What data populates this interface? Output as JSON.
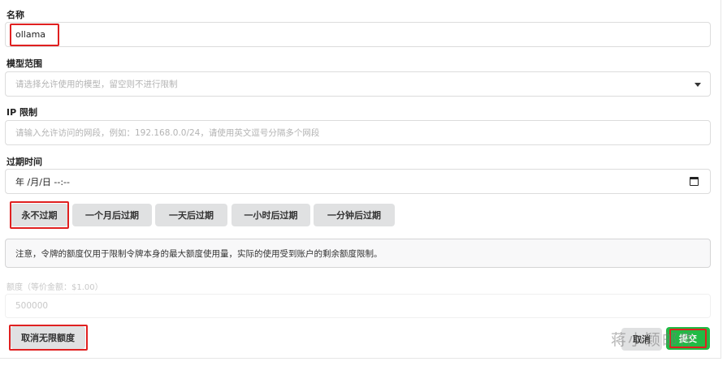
{
  "form": {
    "name": {
      "label": "名称",
      "value": "ollama"
    },
    "model_scope": {
      "label": "模型范围",
      "placeholder": "请选择允许使用的模型，留空则不进行限制"
    },
    "ip_limit": {
      "label": "IP 限制",
      "placeholder": "请输入允许访问的网段，例如：192.168.0.0/24，请使用英文逗号分隔多个网段"
    },
    "expire_time": {
      "label": "过期时间",
      "value": "年 /月/日 --:--"
    },
    "expire_buttons": [
      "永不过期",
      "一个月后过期",
      "一天后过期",
      "一小时后过期",
      "一分钟后过期"
    ],
    "notice": "注意，令牌的额度仅用于限制令牌本身的最大额度使用量，实际的使用受到账户的剩余额度限制。",
    "quota": {
      "label": "额度（等价金额：$1.00）",
      "placeholder": "500000"
    }
  },
  "actions": {
    "cancel_unlimited": "取消无限额度",
    "cancel": "取消",
    "submit": "提交"
  },
  "watermark": "蒋小颖邮件",
  "colors": {
    "highlight": "#e02020",
    "submit": "#21ba45",
    "button_gray": "#e0e1e2"
  }
}
